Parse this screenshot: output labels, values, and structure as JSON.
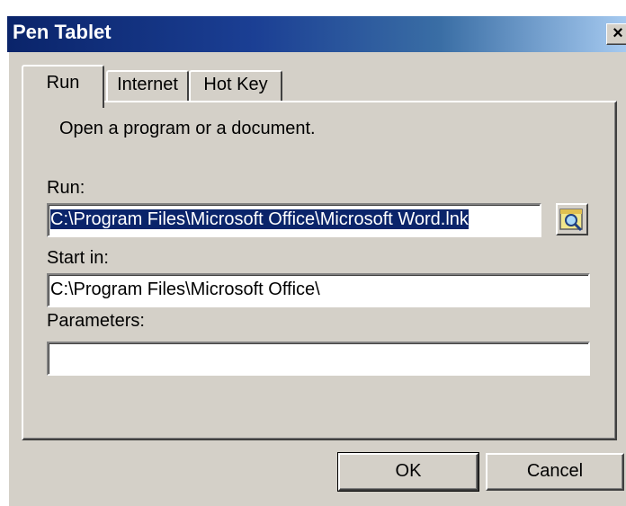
{
  "window": {
    "title": "Pen Tablet",
    "close_glyph": "×"
  },
  "tabs": [
    {
      "label": "Run",
      "active": true
    },
    {
      "label": "Internet",
      "active": false
    },
    {
      "label": "Hot Key",
      "active": false
    }
  ],
  "run_tab": {
    "description": "Open a program or a document.",
    "run_label": "Run:",
    "run_value": "C:\\Program Files\\Microsoft Office\\Microsoft Word.lnk",
    "browse_icon": "browse-magnifier-icon",
    "start_in_label": "Start in:",
    "start_in_value": "C:\\Program Files\\Microsoft Office\\",
    "parameters_label": "Parameters:",
    "parameters_value": ""
  },
  "buttons": {
    "ok": "OK",
    "cancel": "Cancel"
  },
  "colors": {
    "titlebar": "#0a246a",
    "face": "#d4d0c8",
    "selection": "#0a246a"
  }
}
